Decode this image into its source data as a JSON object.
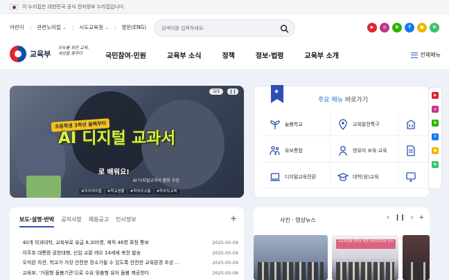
{
  "gov_banner": {
    "text": "이 누리집은 대한민국 공식 전자정부 누리집입니다."
  },
  "util": {
    "links": [
      "어린이",
      "관련누리집",
      "시도교육청",
      "영문(ENG)"
    ],
    "search_placeholder": "검색어를 입력하세요."
  },
  "social": [
    {
      "name": "youtube-icon",
      "color": "#e0262f",
      "glyph": "▶"
    },
    {
      "name": "instagram-icon",
      "color": "#c13584",
      "glyph": "◎"
    },
    {
      "name": "blog-icon",
      "color": "#2db400",
      "glyph": "b"
    },
    {
      "name": "facebook-icon",
      "color": "#1877f2",
      "glyph": "f"
    },
    {
      "name": "kakao-icon",
      "color": "#f2b600",
      "glyph": "●"
    },
    {
      "name": "band-icon",
      "color": "#3cc36b",
      "glyph": "b"
    }
  ],
  "brand": {
    "name": "교육부",
    "slogan": "모두를 위한 교육, 세상을 꿈꾸다"
  },
  "menu": [
    "국민참여·민원",
    "교육부 소식",
    "정책",
    "정보·법령",
    "교육부 소개"
  ],
  "all_menu": "전체메뉴",
  "hero": {
    "counter": "3/3",
    "control": "❙❙",
    "tag": "초등학생 3학년 올해부터",
    "title": "AI 디지털 교과서",
    "subtitle": "로 배워요!",
    "caption": "AI 디지털교과서 활용 수업",
    "hashtags": [
      "#우리아이들",
      "#학교생활",
      "#학부모소통",
      "#학부모교육"
    ]
  },
  "quick": {
    "title_highlight": "주요 메뉴",
    "title_rest": "바로가기",
    "items": [
      {
        "label": "늘봄학교",
        "icon": "sprout-icon",
        "color": "#2b4fb5"
      },
      {
        "label": "교육발전특구",
        "icon": "map-pin-icon",
        "color": "#2b4fb5"
      },
      {
        "label": "",
        "icon": "building-icon",
        "color": "#2b4fb5"
      },
      {
        "label": "유보통합",
        "icon": "family-icon",
        "color": "#2b4fb5"
      },
      {
        "label": "영유아 보육·교육",
        "icon": "child-icon",
        "color": "#2b4fb5"
      },
      {
        "label": "",
        "icon": "document-icon",
        "color": "#2b4fb5"
      },
      {
        "label": "디지털교육전환",
        "icon": "laptop-icon",
        "color": "#2b4fb5"
      },
      {
        "label": "대학(원)교육",
        "icon": "graduation-cap-icon",
        "color": "#2b4fb5"
      },
      {
        "label": "",
        "icon": "monitor-icon",
        "color": "#2b4fb5"
      }
    ]
  },
  "floatbar": [
    {
      "name": "youtube-icon",
      "color": "#e0262f",
      "glyph": "▶"
    },
    {
      "name": "instagram-icon",
      "color": "#c13584",
      "glyph": "◎"
    },
    {
      "name": "blog-icon",
      "color": "#2db400",
      "glyph": "b"
    },
    {
      "name": "facebook-icon",
      "color": "#1877f2",
      "glyph": "f"
    },
    {
      "name": "kakao-icon",
      "color": "#f2b600",
      "glyph": "●"
    },
    {
      "name": "band-icon",
      "color": "#3cc36b",
      "glyph": "b"
    }
  ],
  "news": {
    "tabs": [
      "보도·설명·반박",
      "공지사항",
      "채용공고",
      "인사정보"
    ],
    "more": "+",
    "items": [
      {
        "title": "40개 의과대학, 교육부로 유급 8,305명, 제적 46명 확정 통보",
        "date": "2025-05-09"
      },
      {
        "title": "이주호 대통령 권한대행, 신임 교황 레오 14세에 축전 발송",
        "date": "2025-05-09"
      },
      {
        "title": "오석환 차관, 학교가 가장 안전한 장소가될 수 있도록 안전한 교육환경 조성 ...",
        "date": "2025-05-09"
      },
      {
        "title": "교육부, '거점형 돌봄기관'으로 수요 맞춤형 유아 돌봄 제공한다",
        "date": "2025-05-08"
      }
    ]
  },
  "video": {
    "title": "사진 · 영상뉴스",
    "controls": [
      "‹",
      "❙❙",
      "›",
      "+"
    ],
    "thumb_caption": "고교학점제 안착을 위한 진로진학교사 연수"
  }
}
